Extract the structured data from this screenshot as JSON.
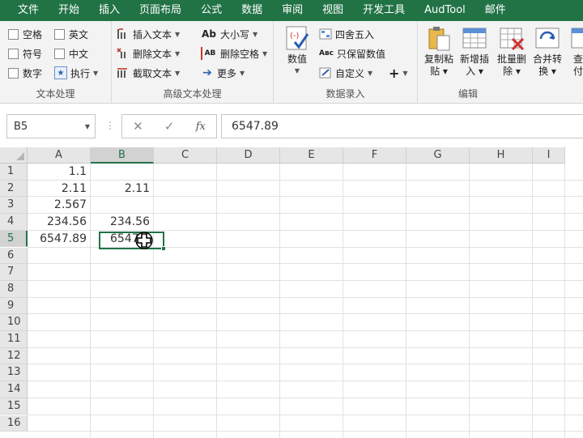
{
  "tabs": [
    "文件",
    "开始",
    "插入",
    "页面布局",
    "公式",
    "数据",
    "审阅",
    "视图",
    "开发工具",
    "AudTool",
    "邮件"
  ],
  "ribbon": {
    "text_group": {
      "label": "文本处理",
      "items": [
        "空格",
        "英文",
        "符号",
        "中文",
        "数字",
        "执行"
      ]
    },
    "adv_group": {
      "label": "高级文本处理",
      "insert_text": "插入文本",
      "delete_text": "删除文本",
      "extract_text": "截取文本",
      "case": "大小写",
      "delete_space": "删除空格",
      "more": "更多",
      "case_icon_text": "Ab",
      "del_space_icon_text": "AB"
    },
    "data_group": {
      "label": "数据录入",
      "value": "数值",
      "round": "四舍五入",
      "keep_value": "只保留数值",
      "custom": "自定义",
      "plus": "+",
      "keep_icon_text": "Aʙc"
    },
    "edit_group": {
      "label": "编辑",
      "copy_paste": [
        "复制粘",
        "贴"
      ],
      "new_insert": [
        "新增插",
        "入"
      ],
      "batch_delete": [
        "批量删",
        "除"
      ],
      "merge_convert": [
        "合并转",
        "换"
      ],
      "partial": [
        "查",
        "付"
      ]
    }
  },
  "formula_bar": {
    "name_box": "B5",
    "cancel": "✕",
    "confirm": "✓",
    "fx": "fx",
    "value": "6547.89"
  },
  "grid": {
    "columns": [
      "A",
      "B",
      "C",
      "D",
      "E",
      "F",
      "G",
      "H",
      "I"
    ],
    "rows": [
      "1",
      "2",
      "3",
      "4",
      "5",
      "6",
      "7",
      "8",
      "9",
      "10",
      "11",
      "12",
      "13",
      "14",
      "15",
      "16"
    ],
    "col_a": [
      "1.1",
      "2.11",
      "2.567",
      "234.56",
      "6547.89"
    ],
    "col_b": [
      "",
      "2.11",
      "",
      "234.56",
      "6547.8"
    ],
    "selected_cell": "B5"
  },
  "colors": {
    "accent": "#217346",
    "ribbon_bg": "#f3f3f3",
    "header_bg": "#e6e6e6"
  }
}
